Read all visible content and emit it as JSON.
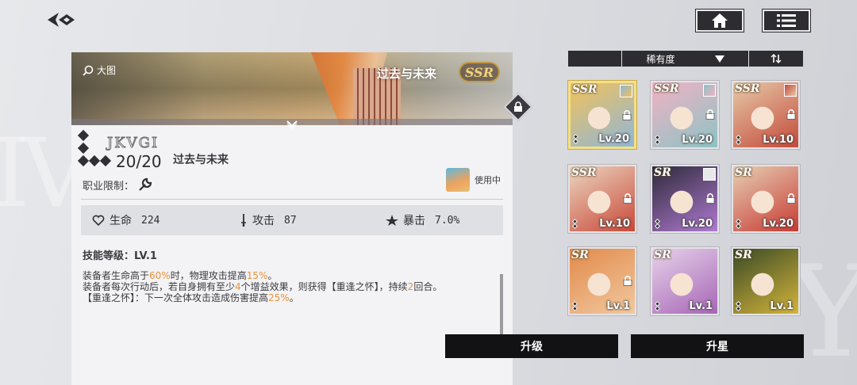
{
  "header": {
    "back_icon": "back-arrow-icon",
    "home_icon": "home-icon",
    "menu_icon": "list-menu-icon"
  },
  "detail": {
    "big_image_label": "大图",
    "banner_title": "过去与未来",
    "rarity": "SSR",
    "signature": "JKVGI",
    "count": "20/20",
    "name": "过去与未来",
    "job_restriction_label": "职业限制：",
    "in_use_label": "使用中",
    "stats": [
      {
        "label": "生命",
        "value": "224",
        "icon": "heart-icon"
      },
      {
        "label": "攻击",
        "value": "87",
        "icon": "sword-icon"
      },
      {
        "label": "暴击",
        "value": "7.0%",
        "icon": "crit-icon"
      }
    ],
    "skill_level": "技能等级：LV.1",
    "desc": {
      "line1_a": "装备者生命高于",
      "line1_hl1": "60%",
      "line1_b": "时，物理攻击提高",
      "line1_hl2": "15%",
      "line1_c": "。",
      "line2_a": "装备者每次行动后，若自身拥有至少",
      "line2_hl1": "4",
      "line2_b": "个增益效果，则获得【重逢之怀】，持续",
      "line2_hl2": "2",
      "line2_c": "回合。",
      "line3_a": "【重逢之怀】：下一次全体攻击造成伤害提高",
      "line3_hl": "25%",
      "line3_b": "。"
    }
  },
  "sort": {
    "label": "稀有度",
    "dropdown_icon": "triangle-down-icon",
    "order_icon": "sort-order-icon"
  },
  "cards": [
    {
      "rarity": "SSR",
      "level": "Lv.20",
      "colors": [
        "#f2c25a",
        "#8fb6d8"
      ]
    },
    {
      "rarity": "SSR",
      "level": "Lv.20",
      "colors": [
        "#f2b2c4",
        "#8cc3c4"
      ]
    },
    {
      "rarity": "SSR",
      "level": "Lv.10",
      "colors": [
        "#e6c9a8",
        "#c34a3a"
      ]
    },
    {
      "rarity": "SSR",
      "level": "Lv.10",
      "colors": [
        "#ecd6c0",
        "#c84838"
      ]
    },
    {
      "rarity": "SR",
      "level": "Lv.20",
      "colors": [
        "#2e2a3a",
        "#b07ad2"
      ]
    },
    {
      "rarity": "SR",
      "level": "Lv.20",
      "colors": [
        "#e6cfb4",
        "#c73a32"
      ]
    },
    {
      "rarity": "SR",
      "level": "Lv.1",
      "colors": [
        "#e28a4a",
        "#f1c9a0"
      ]
    },
    {
      "rarity": "SR",
      "level": "Lv.1",
      "colors": [
        "#e6d2ea",
        "#a766b6"
      ]
    },
    {
      "rarity": "SR",
      "level": "Lv.1",
      "colors": [
        "#3a4a26",
        "#d4b43a"
      ]
    }
  ],
  "buttons": {
    "upgrade": "升级",
    "star_up": "升星"
  }
}
